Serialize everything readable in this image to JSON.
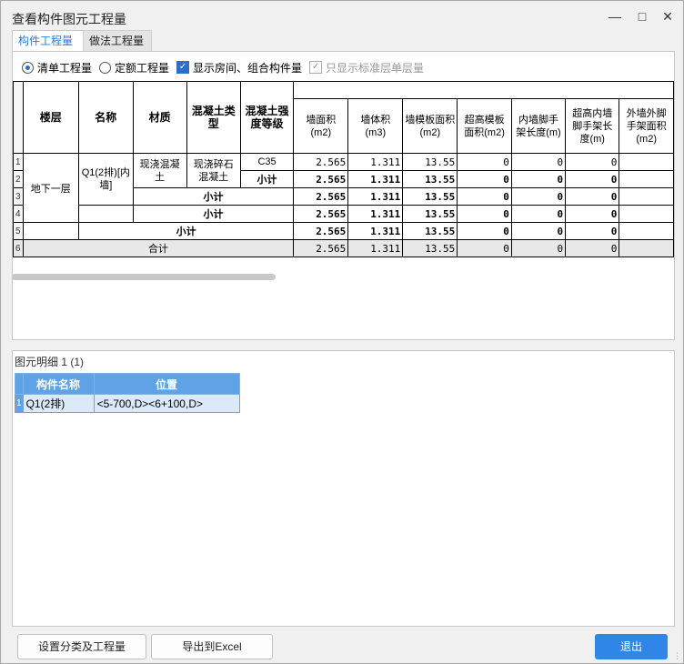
{
  "window": {
    "title": "查看构件图元工程量"
  },
  "tabs": [
    {
      "label": "构件工程量"
    },
    {
      "label": "做法工程量"
    }
  ],
  "options": {
    "radio_list": "清单工程量",
    "radio_quota": "定额工程量",
    "show_room": "显示房间、组合构件量",
    "only_std": "只显示标准层单层量"
  },
  "table": {
    "headers": {
      "floor": "楼层",
      "name": "名称",
      "material": "材质",
      "concrete_type": "混凝土类型",
      "concrete_grade": "混凝土强度等级",
      "wall_area": "墙面积(m2)",
      "wall_volume": "墙体积(m3)",
      "wall_formwork": "墙模板面积(m2)",
      "high_formwork": "超高模板面积(m2)",
      "inner_scaffold": "内墙脚手架长度(m)",
      "high_inner_scaffold": "超高内墙脚手架长度(m)",
      "outer_scaffold": "外墙外脚手架面积(m2)"
    },
    "row_numbers": [
      "1",
      "2",
      "3",
      "4",
      "5",
      "6"
    ],
    "floor": "地下一层",
    "name": "Q1(2排)[内墙]",
    "material": "现浇混凝土",
    "concrete_type": "现浇碎石混凝土",
    "concrete_grade": "C35",
    "subtotal_label": "小计",
    "total_label": "合计",
    "rows": [
      {
        "area": "2.565",
        "volume": "1.311",
        "formwork": "13.55",
        "high_formwork": "0",
        "inner": "0",
        "high_inner": "0"
      },
      {
        "area": "2.565",
        "volume": "1.311",
        "formwork": "13.55",
        "high_formwork": "0",
        "inner": "0",
        "high_inner": "0"
      },
      {
        "area": "2.565",
        "volume": "1.311",
        "formwork": "13.55",
        "high_formwork": "0",
        "inner": "0",
        "high_inner": "0"
      },
      {
        "area": "2.565",
        "volume": "1.311",
        "formwork": "13.55",
        "high_formwork": "0",
        "inner": "0",
        "high_inner": "0"
      },
      {
        "area": "2.565",
        "volume": "1.311",
        "formwork": "13.55",
        "high_formwork": "0",
        "inner": "0",
        "high_inner": "0"
      },
      {
        "area": "2.565",
        "volume": "1.311",
        "formwork": "13.55",
        "high_formwork": "0",
        "inner": "0",
        "high_inner": "0"
      }
    ]
  },
  "detail": {
    "title": "图元明细  1 (1)",
    "col_name": "构件名称",
    "col_pos": "位置",
    "row_num": "1",
    "row_name": "Q1(2排)",
    "row_pos": "<5-700,D><6+100,D>"
  },
  "buttons": {
    "set_category": "设置分类及工程量",
    "export_excel": "导出到Excel",
    "exit": "退出"
  }
}
